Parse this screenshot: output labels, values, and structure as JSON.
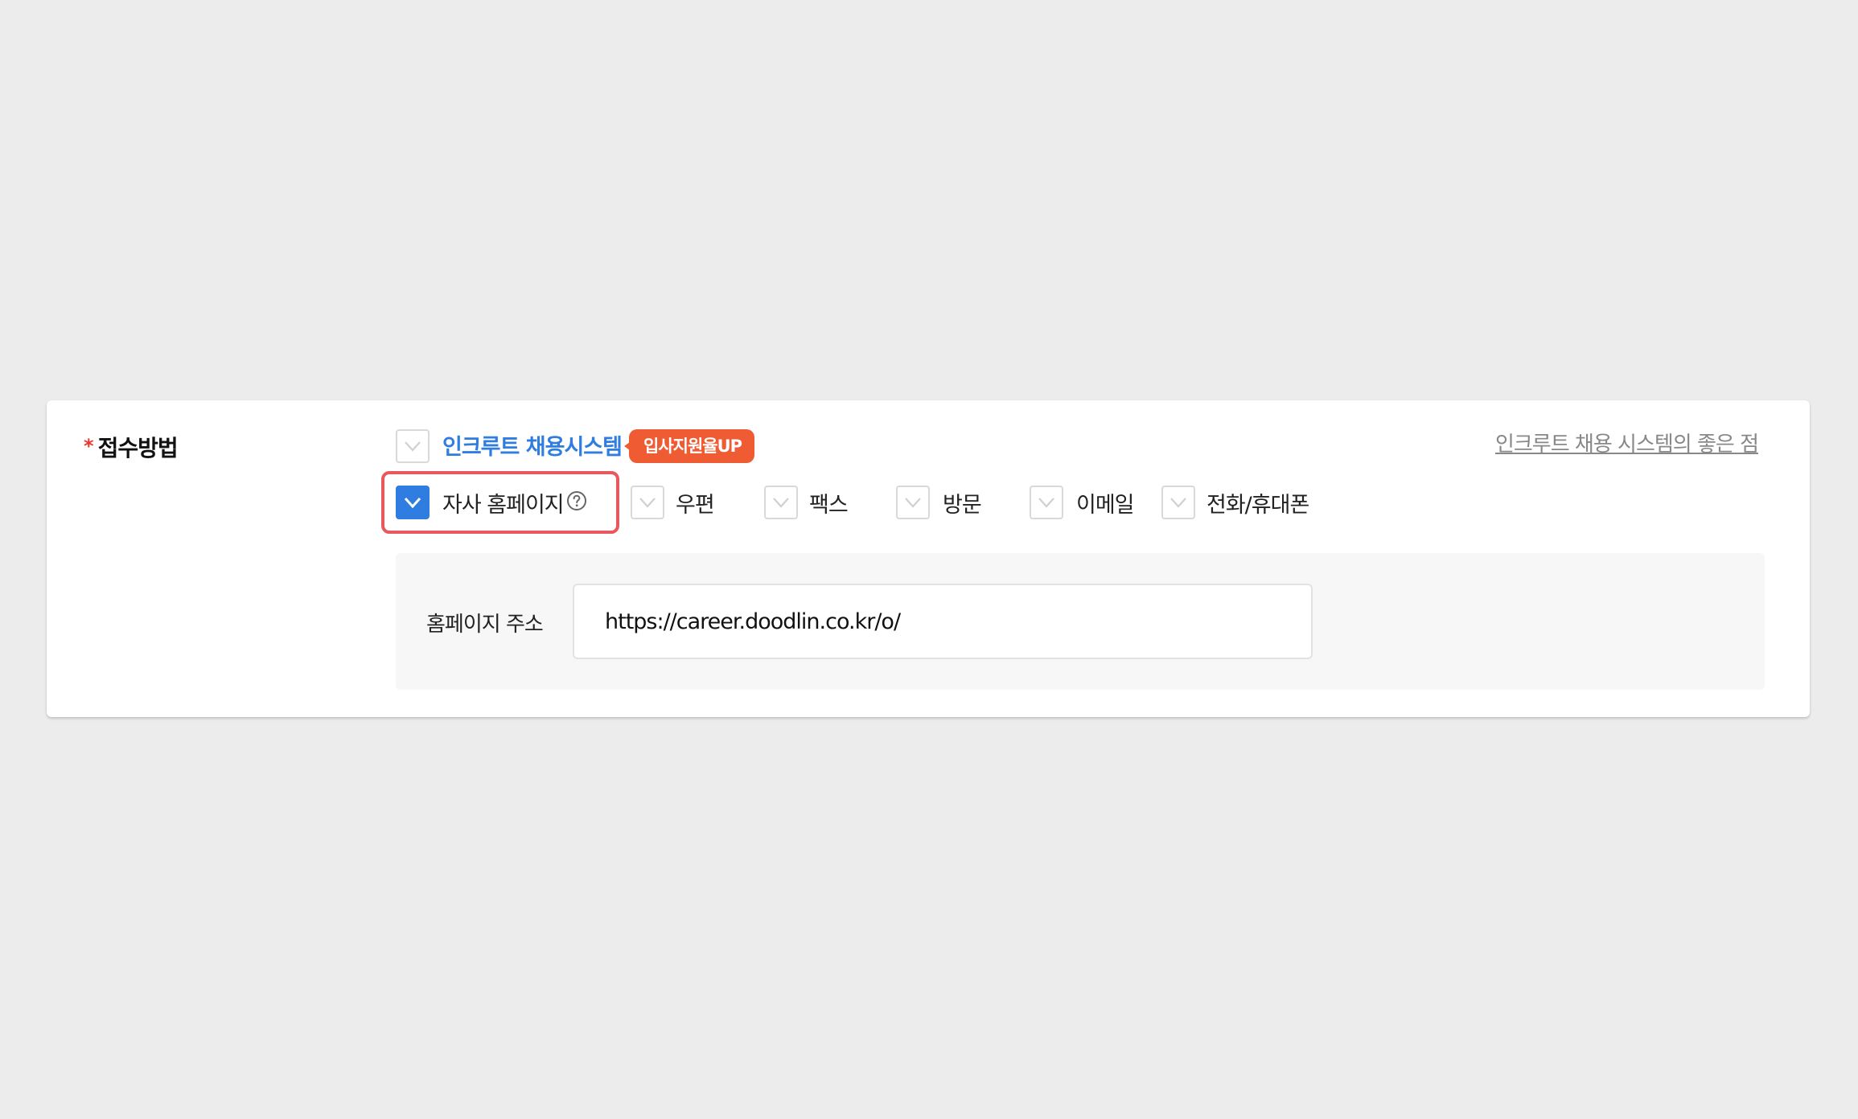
{
  "form": {
    "field_label": "접수방법",
    "required_mark": "*",
    "incruit": {
      "label": "인크루트 채용시스템",
      "badge": "입사지원율UP",
      "checked": false
    },
    "benefit_link": "인크루트 채용 시스템의 좋은 점",
    "options": [
      {
        "label": "자사 홈페이지",
        "checked": true
      },
      {
        "label": "우편",
        "checked": false
      },
      {
        "label": "팩스",
        "checked": false
      },
      {
        "label": "방문",
        "checked": false
      },
      {
        "label": "이메일",
        "checked": false
      },
      {
        "label": "전화/휴대폰",
        "checked": false
      }
    ],
    "homepage": {
      "label": "홈페이지 주소",
      "value": "https://career.doodlin.co.kr/o/"
    }
  },
  "colors": {
    "accent": "#2f7de1",
    "badge": "#ef5b33",
    "highlight": "#e8585c",
    "required": "#e8382e"
  },
  "icons": {
    "check": "check-icon",
    "help": "help-circle-icon"
  }
}
